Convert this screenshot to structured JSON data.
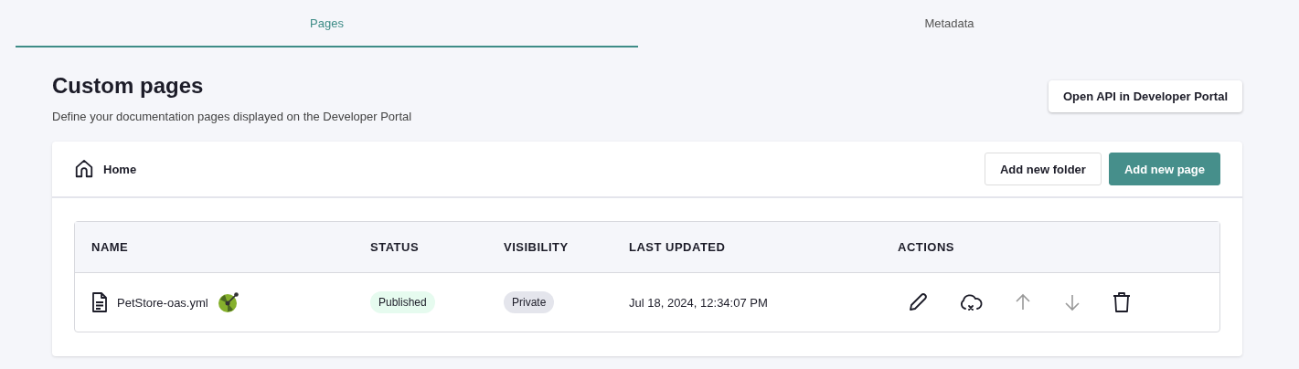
{
  "tabs": [
    {
      "label": "Pages",
      "selected": true
    },
    {
      "label": "Metadata",
      "selected": false
    }
  ],
  "header": {
    "title": "Custom pages",
    "subtitle": "Define your documentation pages displayed on the Developer Portal",
    "button": "Open API in Developer Portal"
  },
  "breadcrumb": {
    "label": "Home"
  },
  "toolbar": {
    "secondary_button": "Add new folder",
    "primary_button": "Add new page"
  },
  "table": {
    "columns": [
      "NAME",
      "STATUS",
      "VISIBILITY",
      "LAST UPDATED",
      "ACTIONS"
    ],
    "rows": [
      {
        "name": "PetStore-oas.yml",
        "status": "Published",
        "visibility": "Private",
        "last_updated": "Jul 18, 2024, 12:34:07 PM",
        "actions": [
          {
            "kind": "edit",
            "disabled": false
          },
          {
            "kind": "unpublish",
            "disabled": false
          },
          {
            "kind": "up",
            "disabled": true
          },
          {
            "kind": "down",
            "disabled": true
          },
          {
            "kind": "delete",
            "disabled": false
          }
        ]
      }
    ]
  }
}
